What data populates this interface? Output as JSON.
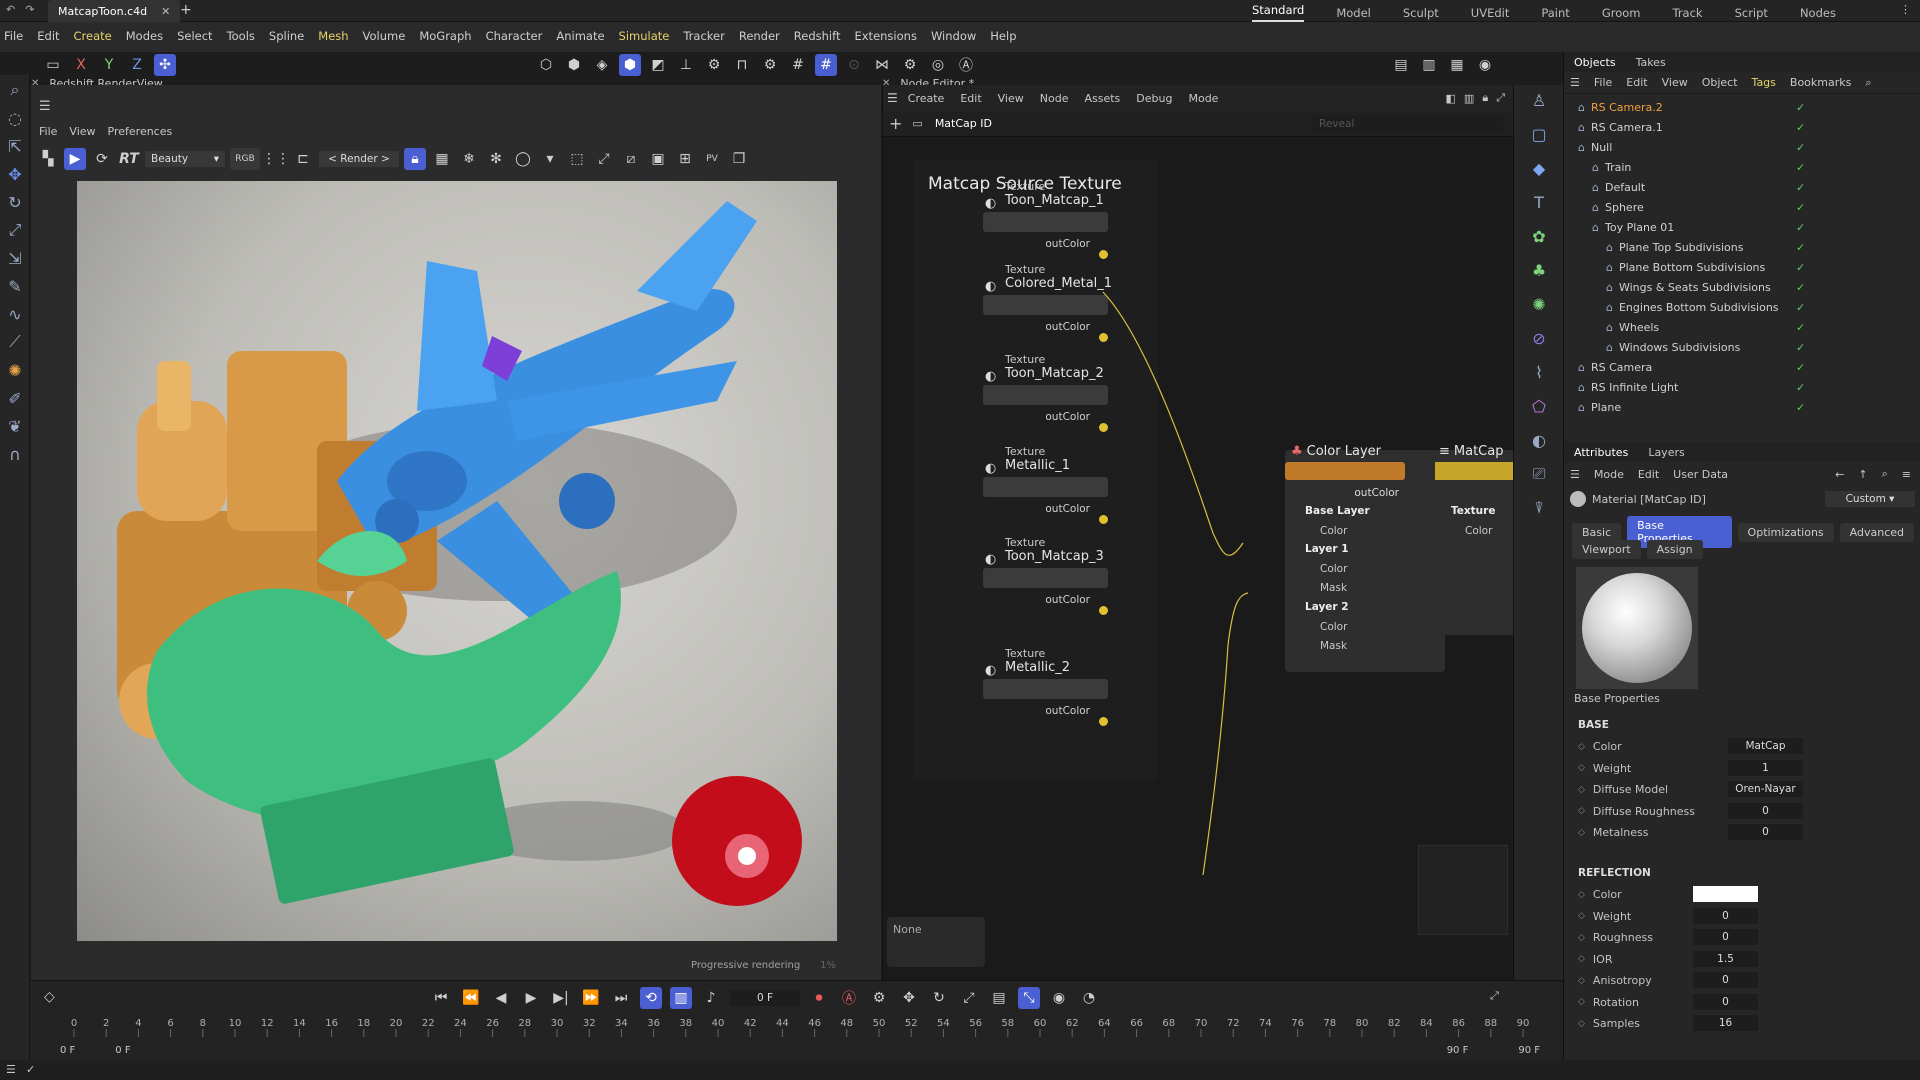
{
  "topbar": {
    "tab": "MatcapToon.c4d",
    "layouts": [
      "Standard",
      "Model",
      "Sculpt",
      "UVEdit",
      "Paint",
      "Groom",
      "Track",
      "Script",
      "Nodes"
    ]
  },
  "menu": [
    "File",
    "Edit",
    "Create",
    "Modes",
    "Select",
    "Tools",
    "Spline",
    "Mesh",
    "Volume",
    "MoGraph",
    "Character",
    "Animate",
    "Simulate",
    "Tracker",
    "Render",
    "Redshift",
    "Extensions",
    "Window",
    "Help"
  ],
  "render_view": {
    "title": "Redshift RenderView",
    "menu": [
      "File",
      "View",
      "Preferences"
    ],
    "pass": "Beauty",
    "channel": "RGB",
    "mode": "< Render >",
    "status": "Progressive rendering",
    "percent": "1%"
  },
  "node_editor": {
    "title": "Node Editor *",
    "menu": [
      "Create",
      "Edit",
      "View",
      "Node",
      "Assets",
      "Debug",
      "Mode"
    ],
    "path": "MatCap ID",
    "search_placeholder": "Reveal",
    "group_title": "Matcap Source Texture",
    "nodes": [
      {
        "type": "Texture",
        "name": "Toon_Matcap_1",
        "out": "outColor"
      },
      {
        "type": "Texture",
        "name": "Colored_Metal_1",
        "out": "outColor"
      },
      {
        "type": "Texture",
        "name": "Toon_Matcap_2",
        "out": "outColor"
      },
      {
        "type": "Texture",
        "name": "Metallic_1",
        "out": "outColor"
      },
      {
        "type": "Texture",
        "name": "Toon_Matcap_3",
        "out": "outColor"
      },
      {
        "type": "Texture",
        "name": "Metallic_2",
        "out": "outColor"
      }
    ],
    "color_layer": {
      "title": "Color Layer",
      "out": "outColor",
      "base": "Base Layer",
      "l1": "Layer 1",
      "l2": "Layer 2",
      "color": "Color",
      "mask": "Mask"
    },
    "matcap": {
      "title": "MatCap",
      "sub": "Texture",
      "color": "Color"
    },
    "none_label": "None"
  },
  "objects": {
    "tabs": [
      "Objects",
      "Takes"
    ],
    "menu": [
      "File",
      "Edit",
      "View",
      "Object",
      "Tags",
      "Bookmarks"
    ],
    "items": [
      {
        "name": "RS Camera.2",
        "indent": 0
      },
      {
        "name": "RS Camera.1",
        "indent": 0
      },
      {
        "name": "Null",
        "indent": 0
      },
      {
        "name": "Train",
        "indent": 1
      },
      {
        "name": "Default",
        "indent": 1
      },
      {
        "name": "Sphere",
        "indent": 1
      },
      {
        "name": "Toy Plane 01",
        "indent": 1
      },
      {
        "name": "Plane Top Subdivisions",
        "indent": 2
      },
      {
        "name": "Plane Bottom Subdivisions",
        "indent": 2
      },
      {
        "name": "Wings & Seats Subdivisions",
        "indent": 2
      },
      {
        "name": "Engines Bottom Subdivisions",
        "indent": 2
      },
      {
        "name": "Wheels",
        "indent": 2
      },
      {
        "name": "Windows Subdivisions",
        "indent": 2
      },
      {
        "name": "RS Camera",
        "indent": 0
      },
      {
        "name": "RS Infinite Light",
        "indent": 0
      },
      {
        "name": "Plane",
        "indent": 0
      }
    ]
  },
  "attributes": {
    "tabs": [
      "Attributes",
      "Layers"
    ],
    "menu": [
      "Mode",
      "Edit",
      "User Data"
    ],
    "material": "Material [MatCap ID]",
    "preset": "Custom",
    "subtabs": [
      "Basic",
      "Base Properties",
      "Optimizations",
      "Advanced",
      "Viewport",
      "Assign"
    ],
    "section": "Base Properties",
    "base": {
      "title": "BASE",
      "rows": [
        {
          "label": "Color",
          "value": "MatCap"
        },
        {
          "label": "Weight",
          "value": "1"
        },
        {
          "label": "Diffuse Model",
          "value": "Oren-Nayar"
        },
        {
          "label": "Diffuse Roughness",
          "value": "0"
        },
        {
          "label": "Metalness",
          "value": "0"
        }
      ]
    },
    "reflection": {
      "title": "REFLECTION",
      "rows": [
        {
          "label": "Color",
          "value": ""
        },
        {
          "label": "Weight",
          "value": "0"
        },
        {
          "label": "Roughness",
          "value": "0"
        },
        {
          "label": "IOR",
          "value": "1.5"
        },
        {
          "label": "Anisotropy",
          "value": "0"
        },
        {
          "label": "Rotation",
          "value": "0"
        },
        {
          "label": "Samples",
          "value": "16"
        }
      ]
    }
  },
  "timeline": {
    "frame": "0 F",
    "ticks": [
      "0",
      "2",
      "4",
      "6",
      "8",
      "10",
      "12",
      "14",
      "16",
      "18",
      "20",
      "22",
      "24",
      "26",
      "28",
      "30",
      "32",
      "34",
      "36",
      "38",
      "40",
      "42",
      "44",
      "46",
      "48",
      "50",
      "52",
      "54",
      "56",
      "58",
      "60",
      "62",
      "64",
      "66",
      "68",
      "70",
      "72",
      "74",
      "76",
      "78",
      "80",
      "82",
      "84",
      "86",
      "88",
      "90"
    ],
    "start": "0 F",
    "start2": "0 F",
    "end": "90 F",
    "end2": "90 F"
  },
  "axes": [
    "X",
    "Y",
    "Z"
  ]
}
